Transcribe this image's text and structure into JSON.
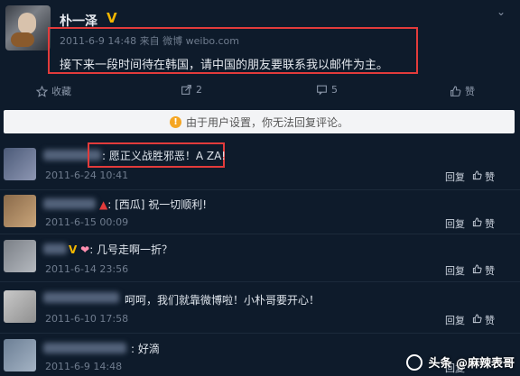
{
  "post": {
    "username": "朴一泽",
    "verified_badge": "V",
    "timestamp": "2011-6-9 14:48",
    "source": "来自 微博 weibo.com",
    "text": "接下来一段时间待在韩国，请中国的朋友要联系我以邮件为主。"
  },
  "actions": {
    "favorite_label": "收藏",
    "repost_count": "2",
    "comment_count": "5",
    "like_label": "赞"
  },
  "notice": {
    "text": "由于用户设置，你无法回复评论。"
  },
  "comments": [
    {
      "text": ": 愿正义战胜邪恶！A ZA!",
      "time": "2011-6-24 10:41",
      "reply": "回复",
      "like": "赞"
    },
    {
      "text": "[西瓜] 祝一切顺利!",
      "time": "2011-6-15 00:09",
      "reply": "回复",
      "like": "赞"
    },
    {
      "text": ": 几号走啊一折？",
      "time": "2011-6-14 23:56",
      "reply": "回复",
      "like": "赞"
    },
    {
      "text": "呵呵，我们就靠微博啦！小朴哥要开心！",
      "time": "2011-6-10 17:58",
      "reply": "回复",
      "like": "赞"
    },
    {
      "text": ": 好滴",
      "time": "2011-6-9 14:48",
      "reply": "回复",
      "like": "赞"
    }
  ],
  "watermark": "头条 @麻辣表哥",
  "icons": {
    "favorite": "star-icon",
    "repost": "share-icon",
    "comment": "comment-icon",
    "like": "thumbs-up-icon",
    "notice": "warning-icon",
    "more": "chevron-down-icon"
  },
  "colors": {
    "background": "#0e1b2b",
    "highlight_box": "#e23b3b",
    "verified": "#f2b600"
  }
}
